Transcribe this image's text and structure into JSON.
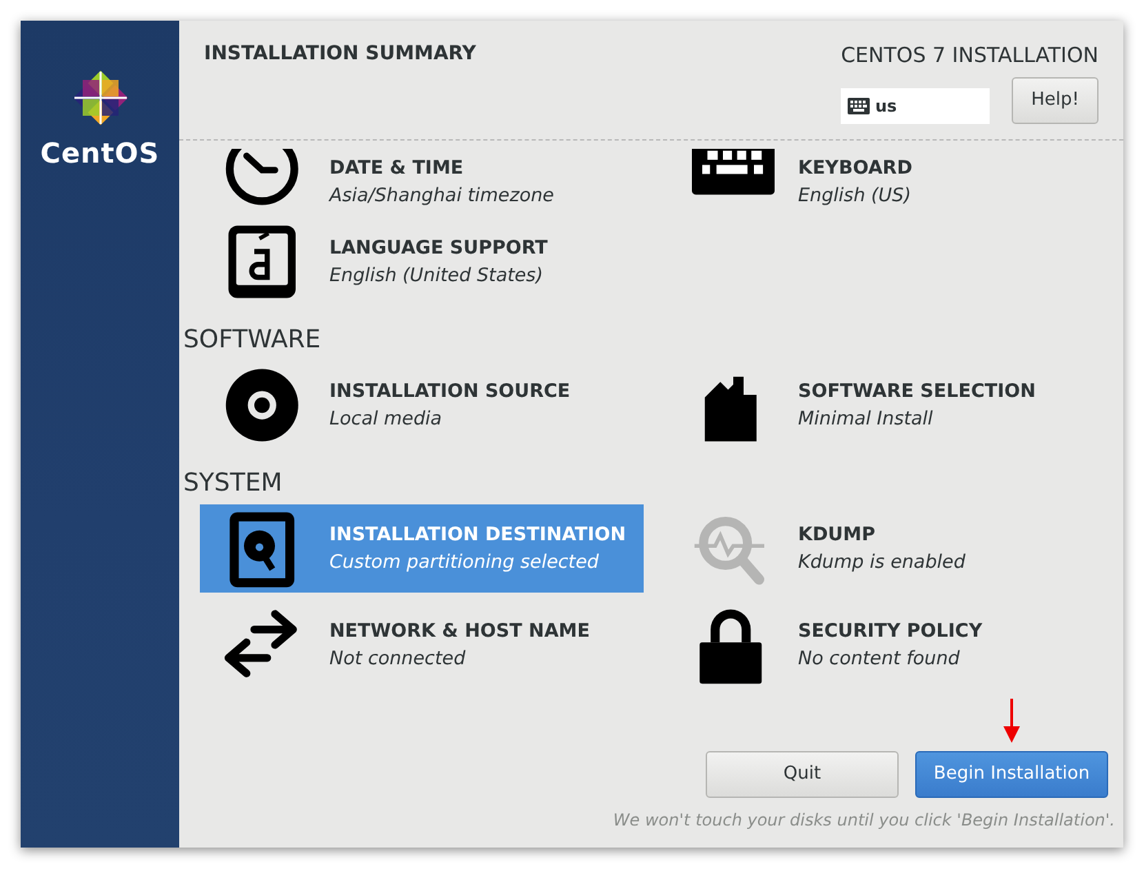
{
  "sidebar": {
    "logo_text": "CentOS"
  },
  "header": {
    "title": "INSTALLATION SUMMARY",
    "product": "CENTOS 7 INSTALLATION",
    "keyboard_layout": "us",
    "help_button": "Help!"
  },
  "sections": [
    {
      "spokes": [
        {
          "title": "DATE & TIME",
          "status": "Asia/Shanghai timezone",
          "selected": false
        },
        {
          "title": "KEYBOARD",
          "status": "English (US)",
          "selected": false
        },
        {
          "title": "LANGUAGE SUPPORT",
          "status": "English (United States)",
          "selected": false
        }
      ]
    },
    {
      "title": "SOFTWARE",
      "spokes": [
        {
          "title": "INSTALLATION SOURCE",
          "status": "Local media",
          "selected": false
        },
        {
          "title": "SOFTWARE SELECTION",
          "status": "Minimal Install",
          "selected": false
        }
      ]
    },
    {
      "title": "SYSTEM",
      "spokes": [
        {
          "title": "INSTALLATION DESTINATION",
          "status": "Custom partitioning selected",
          "selected": true
        },
        {
          "title": "KDUMP",
          "status": "Kdump is enabled",
          "selected": false
        },
        {
          "title": "NETWORK & HOST NAME",
          "status": "Not connected",
          "selected": false
        },
        {
          "title": "SECURITY POLICY",
          "status": "No content found",
          "selected": false
        }
      ]
    }
  ],
  "buttons": [
    {
      "label": "Quit",
      "kind": "secondary"
    },
    {
      "label": "Begin Installation",
      "kind": "primary"
    }
  ],
  "footer_note": "We won't touch your disks until you click 'Begin Installation'."
}
